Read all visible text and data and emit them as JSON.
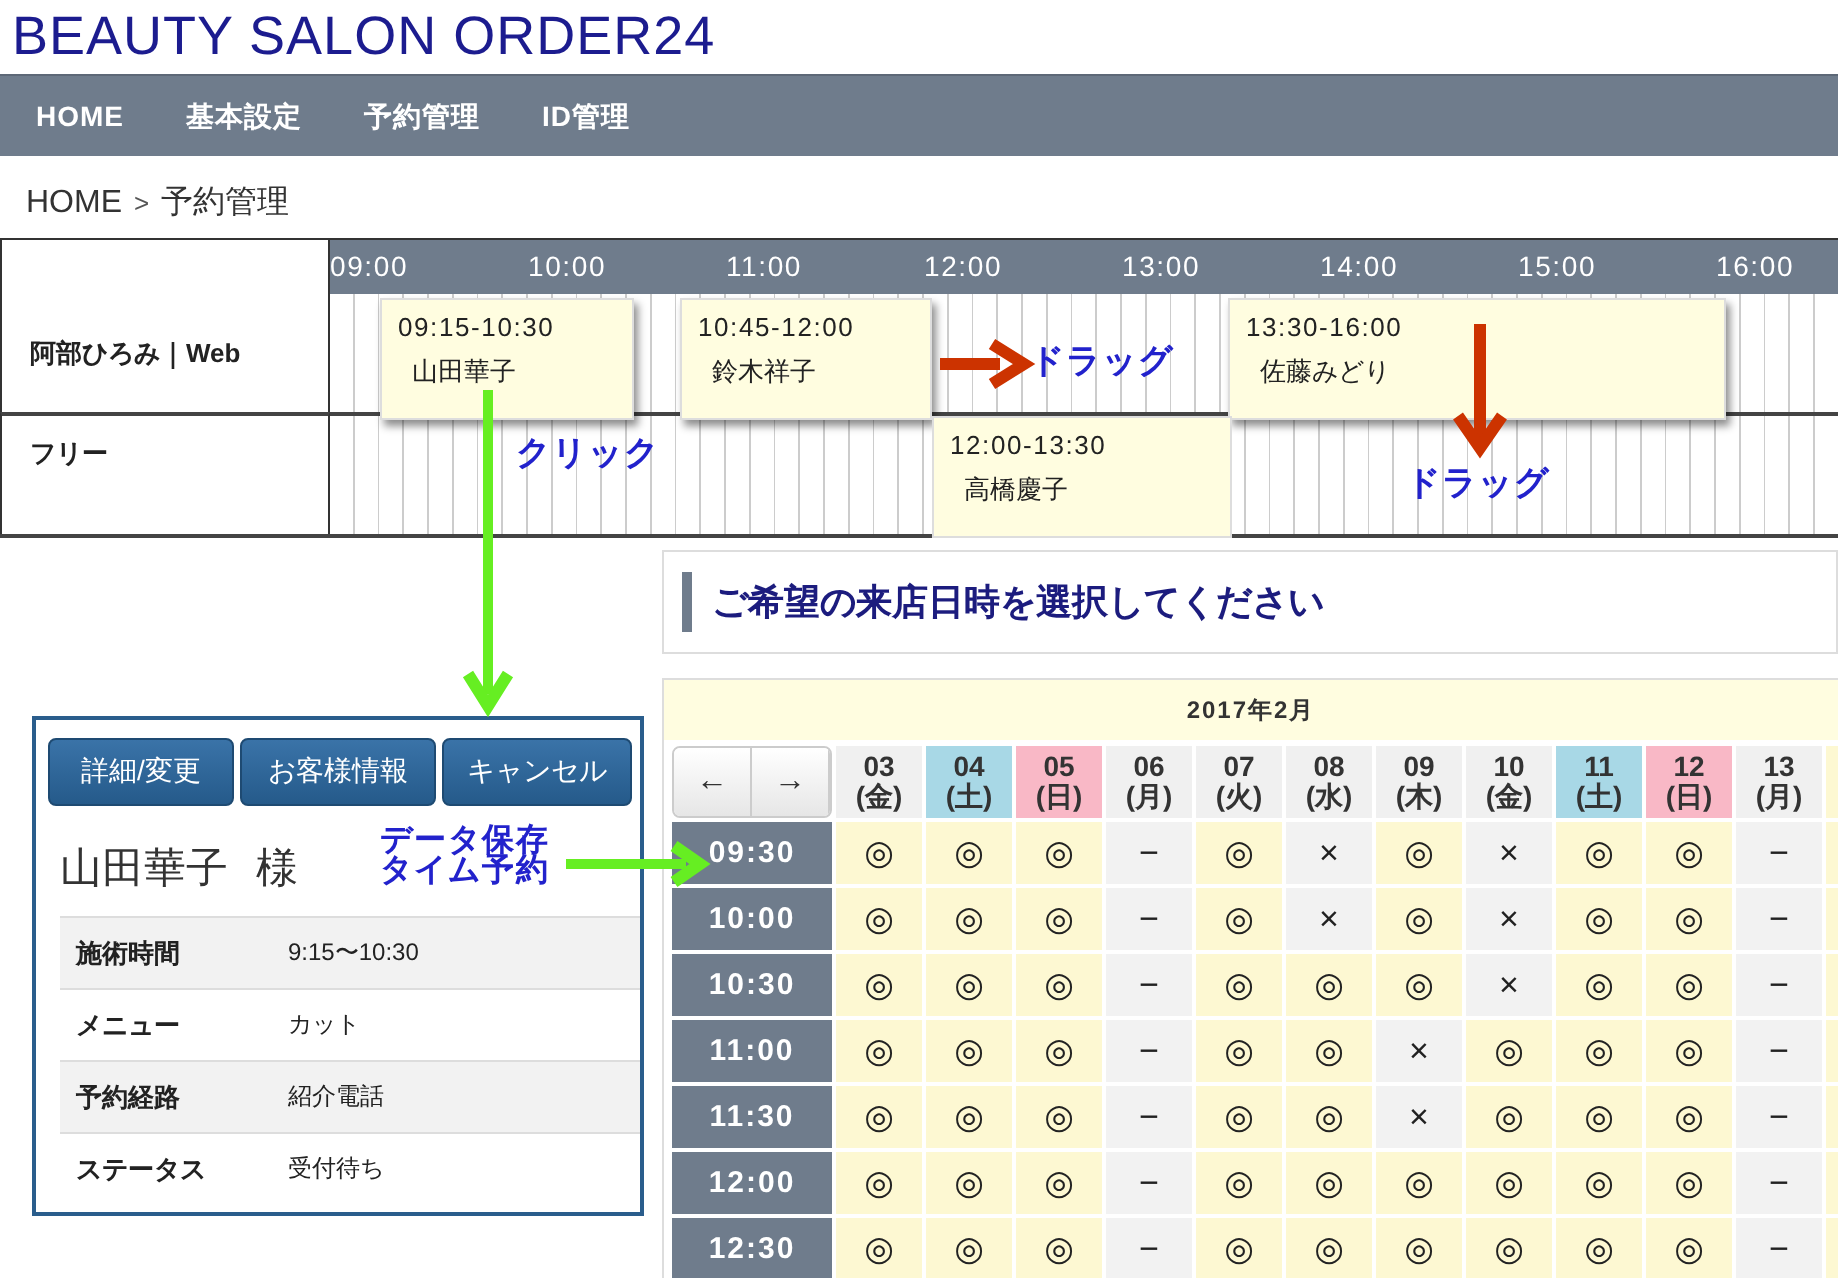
{
  "site_title": "BEAUTY SALON ORDER24",
  "nav": [
    "HOME",
    "基本設定",
    "予約管理",
    "ID管理"
  ],
  "breadcrumb": {
    "home": "HOME",
    "separator": ">",
    "current": "予約管理"
  },
  "timeline": {
    "hours": [
      "09:00",
      "10:00",
      "11:00",
      "12:00",
      "13:00",
      "14:00",
      "15:00",
      "16:00"
    ],
    "staff": [
      {
        "name": "阿部ひろみ｜Web",
        "bookings": [
          {
            "time": "09:15-10:30",
            "customer": "山田華子"
          },
          {
            "time": "10:45-12:00",
            "customer": "鈴木祥子"
          },
          {
            "time": "13:30-16:00",
            "customer": "佐藤みどり"
          }
        ]
      },
      {
        "name": "フリー",
        "bookings": [
          {
            "time": "12:00-13:30",
            "customer": "高橋慶子"
          }
        ]
      }
    ]
  },
  "annotations": {
    "drag_right": "ドラッグ",
    "drag_down": "ドラッグ",
    "click": "クリック",
    "save": [
      "データ保存",
      "タイム予約"
    ]
  },
  "detail": {
    "buttons": [
      "詳細/変更",
      "お客様情報",
      "キャンセル"
    ],
    "customer": "山田華子",
    "honorific": "様",
    "rows": [
      {
        "label": "施術時間",
        "value": "9:15〜10:30"
      },
      {
        "label": "メニュー",
        "value": "カット"
      },
      {
        "label": "予約経路",
        "value": "紹介電話"
      },
      {
        "label": "ステータス",
        "value": "受付待ち"
      }
    ]
  },
  "calendar": {
    "heading": "ご希望の来店日時を選択してください",
    "month": "2017年2月",
    "prev": "←",
    "next": "→",
    "days": [
      {
        "date": "03",
        "weekday": "(金)",
        "kind": "weekday"
      },
      {
        "date": "04",
        "weekday": "(土)",
        "kind": "saturday"
      },
      {
        "date": "05",
        "weekday": "(日)",
        "kind": "sunday"
      },
      {
        "date": "06",
        "weekday": "(月)",
        "kind": "weekday"
      },
      {
        "date": "07",
        "weekday": "(火)",
        "kind": "weekday"
      },
      {
        "date": "08",
        "weekday": "(水)",
        "kind": "weekday"
      },
      {
        "date": "09",
        "weekday": "(木)",
        "kind": "weekday"
      },
      {
        "date": "10",
        "weekday": "(金)",
        "kind": "weekday"
      },
      {
        "date": "11",
        "weekday": "(土)",
        "kind": "saturday"
      },
      {
        "date": "12",
        "weekday": "(日)",
        "kind": "sunday"
      },
      {
        "date": "13",
        "weekday": "(月)",
        "kind": "weekday"
      }
    ],
    "rows": [
      {
        "time": "09:30",
        "cells": [
          {
            "mark": "◎",
            "available": true
          },
          {
            "mark": "◎",
            "available": true
          },
          {
            "mark": "◎",
            "available": true
          },
          {
            "mark": "−",
            "available": false
          },
          {
            "mark": "◎",
            "available": true
          },
          {
            "mark": "×",
            "available": false
          },
          {
            "mark": "◎",
            "available": true
          },
          {
            "mark": "×",
            "available": false
          },
          {
            "mark": "◎",
            "available": true
          },
          {
            "mark": "◎",
            "available": true
          },
          {
            "mark": "−",
            "available": false
          }
        ]
      },
      {
        "time": "10:00",
        "cells": [
          {
            "mark": "◎",
            "available": true
          },
          {
            "mark": "◎",
            "available": true
          },
          {
            "mark": "◎",
            "available": true
          },
          {
            "mark": "−",
            "available": false
          },
          {
            "mark": "◎",
            "available": true
          },
          {
            "mark": "×",
            "available": false
          },
          {
            "mark": "◎",
            "available": true
          },
          {
            "mark": "×",
            "available": false
          },
          {
            "mark": "◎",
            "available": true
          },
          {
            "mark": "◎",
            "available": true
          },
          {
            "mark": "−",
            "available": false
          }
        ]
      },
      {
        "time": "10:30",
        "cells": [
          {
            "mark": "◎",
            "available": true
          },
          {
            "mark": "◎",
            "available": true
          },
          {
            "mark": "◎",
            "available": true
          },
          {
            "mark": "−",
            "available": false
          },
          {
            "mark": "◎",
            "available": true
          },
          {
            "mark": "◎",
            "available": true
          },
          {
            "mark": "◎",
            "available": true
          },
          {
            "mark": "×",
            "available": false
          },
          {
            "mark": "◎",
            "available": true
          },
          {
            "mark": "◎",
            "available": true
          },
          {
            "mark": "−",
            "available": false
          }
        ]
      },
      {
        "time": "11:00",
        "cells": [
          {
            "mark": "◎",
            "available": true
          },
          {
            "mark": "◎",
            "available": true
          },
          {
            "mark": "◎",
            "available": true
          },
          {
            "mark": "−",
            "available": false
          },
          {
            "mark": "◎",
            "available": true
          },
          {
            "mark": "◎",
            "available": true
          },
          {
            "mark": "×",
            "available": false
          },
          {
            "mark": "◎",
            "available": true
          },
          {
            "mark": "◎",
            "available": true
          },
          {
            "mark": "◎",
            "available": true
          },
          {
            "mark": "−",
            "available": false
          }
        ]
      },
      {
        "time": "11:30",
        "cells": [
          {
            "mark": "◎",
            "available": true
          },
          {
            "mark": "◎",
            "available": true
          },
          {
            "mark": "◎",
            "available": true
          },
          {
            "mark": "−",
            "available": false
          },
          {
            "mark": "◎",
            "available": true
          },
          {
            "mark": "◎",
            "available": true
          },
          {
            "mark": "×",
            "available": false
          },
          {
            "mark": "◎",
            "available": true
          },
          {
            "mark": "◎",
            "available": true
          },
          {
            "mark": "◎",
            "available": true
          },
          {
            "mark": "−",
            "available": false
          }
        ]
      },
      {
        "time": "12:00",
        "cells": [
          {
            "mark": "◎",
            "available": true
          },
          {
            "mark": "◎",
            "available": true
          },
          {
            "mark": "◎",
            "available": true
          },
          {
            "mark": "−",
            "available": false
          },
          {
            "mark": "◎",
            "available": true
          },
          {
            "mark": "◎",
            "available": true
          },
          {
            "mark": "◎",
            "available": true
          },
          {
            "mark": "◎",
            "available": true
          },
          {
            "mark": "◎",
            "available": true
          },
          {
            "mark": "◎",
            "available": true
          },
          {
            "mark": "−",
            "available": false
          }
        ]
      },
      {
        "time": "12:30",
        "cells": [
          {
            "mark": "◎",
            "available": true
          },
          {
            "mark": "◎",
            "available": true
          },
          {
            "mark": "◎",
            "available": true
          },
          {
            "mark": "−",
            "available": false
          },
          {
            "mark": "◎",
            "available": true
          },
          {
            "mark": "◎",
            "available": true
          },
          {
            "mark": "◎",
            "available": true
          },
          {
            "mark": "◎",
            "available": true
          },
          {
            "mark": "◎",
            "available": true
          },
          {
            "mark": "◎",
            "available": true
          },
          {
            "mark": "−",
            "available": false
          }
        ]
      }
    ]
  }
}
